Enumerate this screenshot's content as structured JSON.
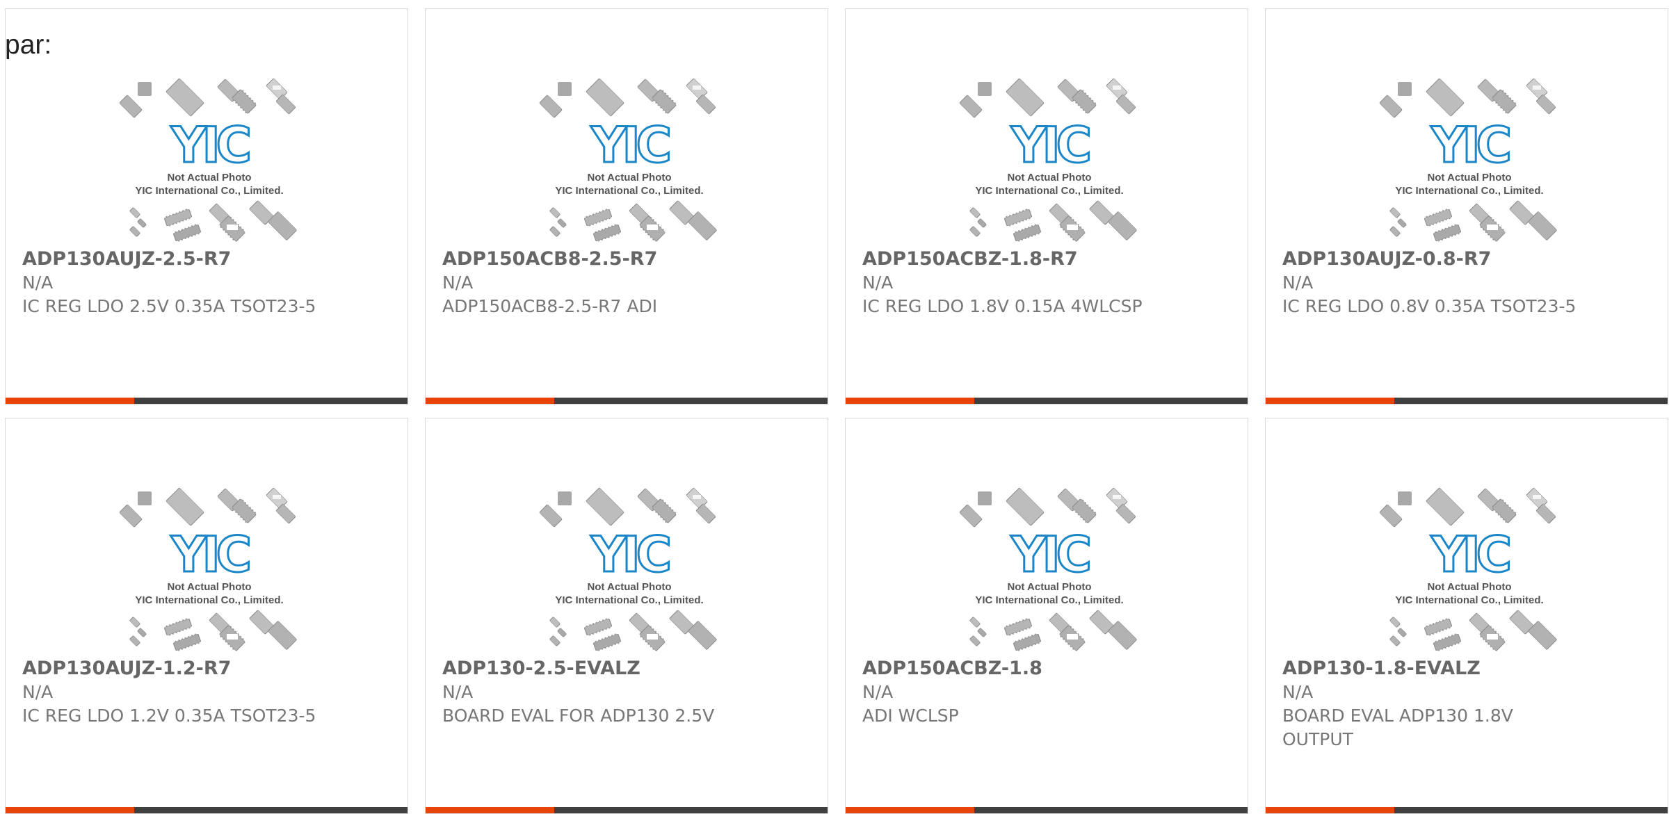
{
  "page": {
    "prefix_text": "par:",
    "colors": {
      "accent": "#e8440a",
      "bar": "#3f3f3f",
      "text": "#666666",
      "logo_blue": "#1a86c8",
      "border": "#d9d9d9"
    }
  },
  "placeholder_image": {
    "brand": "YIC",
    "line1": "Not Actual Photo",
    "line2": "YIC International Co., Limited.",
    "icon": "chip-packages-icon"
  },
  "products": [
    {
      "part_number": "ADP130AUJZ-2.5-R7",
      "manufacturer": "N/A",
      "description": "IC REG LDO 2.5V 0.35A TSOT23-5",
      "bar_fill_pct": 32
    },
    {
      "part_number": "ADP150ACB8-2.5-R7",
      "manufacturer": "N/A",
      "description": "ADP150ACB8-2.5-R7 ADI",
      "bar_fill_pct": 32
    },
    {
      "part_number": "ADP150ACBZ-1.8-R7",
      "manufacturer": "N/A",
      "description": "IC REG LDO 1.8V 0.15A 4WLCSP",
      "bar_fill_pct": 32
    },
    {
      "part_number": "ADP130AUJZ-0.8-R7",
      "manufacturer": "N/A",
      "description": "IC REG LDO 0.8V 0.35A TSOT23-5",
      "bar_fill_pct": 32
    },
    {
      "part_number": "ADP130AUJZ-1.2-R7",
      "manufacturer": "N/A",
      "description": "IC REG LDO 1.2V 0.35A TSOT23-5",
      "bar_fill_pct": 32
    },
    {
      "part_number": "ADP130-2.5-EVALZ",
      "manufacturer": "N/A",
      "description": "BOARD EVAL FOR ADP130 2.5V",
      "bar_fill_pct": 32
    },
    {
      "part_number": "ADP150ACBZ-1.8",
      "manufacturer": "N/A",
      "description": "ADI WCLSP",
      "bar_fill_pct": 32
    },
    {
      "part_number": "ADP130-1.8-EVALZ",
      "manufacturer": "N/A",
      "description": "BOARD EVAL ADP130 1.8V OUTPUT",
      "bar_fill_pct": 32
    }
  ]
}
